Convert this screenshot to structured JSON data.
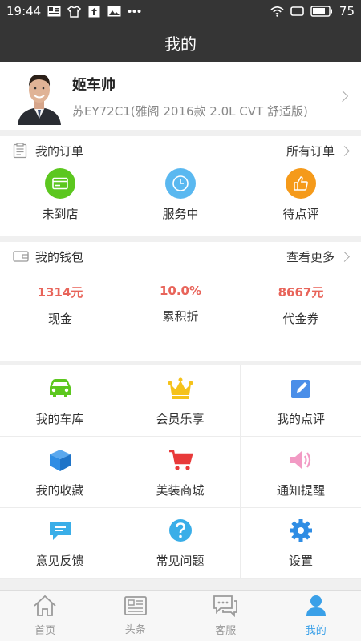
{
  "status_bar": {
    "time": "19:44",
    "battery": "75"
  },
  "header": {
    "title": "我的"
  },
  "profile": {
    "name": "姬车帅",
    "car": "苏EY72C1(雅阁 2016款 2.0L CVT 舒适版)"
  },
  "orders": {
    "title": "我的订单",
    "more": "所有订单",
    "items": [
      {
        "label": "未到店",
        "icon": "card-icon",
        "color": "#5cc71f"
      },
      {
        "label": "服务中",
        "icon": "clock-icon",
        "color": "#5ab8f0"
      },
      {
        "label": "待点评",
        "icon": "thumbs-up-icon",
        "color": "#f59a1a"
      }
    ]
  },
  "wallet": {
    "title": "我的钱包",
    "more": "查看更多",
    "items": [
      {
        "value": "1314元",
        "label": "现金"
      },
      {
        "value": "10.0%",
        "label": "累积折"
      },
      {
        "value": "8667元",
        "label": "代金券"
      }
    ]
  },
  "menu": [
    {
      "label": "我的车库",
      "icon": "car-icon",
      "color": "#5cc71f"
    },
    {
      "label": "会员乐享",
      "icon": "crown-icon",
      "color": "#f5c21a"
    },
    {
      "label": "我的点评",
      "icon": "edit-icon",
      "color": "#4a8ee8"
    },
    {
      "label": "我的收藏",
      "icon": "cube-icon",
      "color": "#2f8de4"
    },
    {
      "label": "美装商城",
      "icon": "cart-icon",
      "color": "#e83a3a"
    },
    {
      "label": "通知提醒",
      "icon": "speaker-icon",
      "color": "#f29ac4"
    },
    {
      "label": "意见反馈",
      "icon": "chat-icon",
      "color": "#3aaee8"
    },
    {
      "label": "常见问题",
      "icon": "question-icon",
      "color": "#3aaee8"
    },
    {
      "label": "设置",
      "icon": "gear-icon",
      "color": "#2f8de4"
    }
  ],
  "tabbar": [
    {
      "label": "首页",
      "icon": "home-icon",
      "active": false
    },
    {
      "label": "头条",
      "icon": "news-icon",
      "active": false
    },
    {
      "label": "客服",
      "icon": "service-chat-icon",
      "active": false
    },
    {
      "label": "我的",
      "icon": "user-icon",
      "active": true
    }
  ],
  "colors": {
    "header_bg": "#353535",
    "accent": "#3aa0e8",
    "value_red": "#e8645a"
  }
}
